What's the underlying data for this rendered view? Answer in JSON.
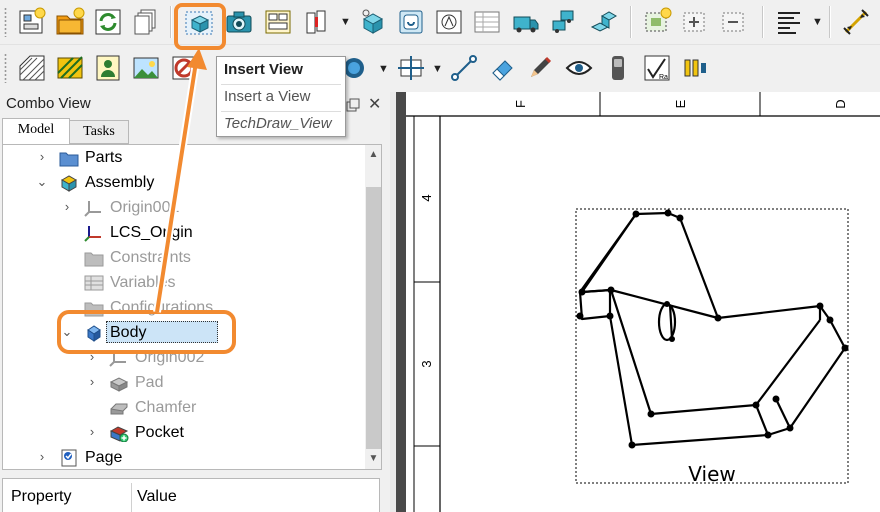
{
  "menu": {
    "items": [
      {
        "label": "Insert View",
        "style": "bold"
      },
      {
        "label": "Insert a View",
        "style": "normal"
      },
      {
        "label": "TechDraw_View",
        "style": "italic"
      }
    ]
  },
  "combo": {
    "title": "Combo View",
    "float_icon": "float-icon",
    "close_glyph": "✕",
    "tabs": [
      "Model",
      "Tasks"
    ]
  },
  "tree": {
    "items": [
      {
        "label": "Parts",
        "icon": "folder-blue-icon",
        "state": "collapsed",
        "grayed": false
      },
      {
        "label": "Assembly",
        "icon": "assembly-icon",
        "state": "expanded",
        "grayed": false
      },
      {
        "label": "Origin001",
        "icon": "origin-icon",
        "state": "collapsed",
        "grayed": true
      },
      {
        "label": "LCS_Origin",
        "icon": "lcs-icon",
        "state": "none",
        "grayed": false
      },
      {
        "label": "Constraints",
        "icon": "folder-gray-icon",
        "state": "none",
        "grayed": true
      },
      {
        "label": "Variables",
        "icon": "variables-icon",
        "state": "none",
        "grayed": true
      },
      {
        "label": "Configurations",
        "icon": "folder-gray-icon",
        "state": "none",
        "grayed": true
      },
      {
        "label": "Body",
        "icon": "body-icon",
        "state": "expanded",
        "grayed": false,
        "selected": true
      },
      {
        "label": "Origin002",
        "icon": "origin-icon",
        "state": "collapsed",
        "grayed": true
      },
      {
        "label": "Pad",
        "icon": "pad-icon",
        "state": "collapsed",
        "grayed": true
      },
      {
        "label": "Chamfer",
        "icon": "chamfer-icon",
        "state": "none",
        "grayed": true
      },
      {
        "label": "Pocket",
        "icon": "pocket-icon",
        "state": "collapsed",
        "grayed": false
      },
      {
        "label": "Page",
        "icon": "page-icon",
        "state": "collapsed",
        "grayed": false
      }
    ]
  },
  "properties": {
    "columns": [
      "Property",
      "Value"
    ]
  },
  "drawing": {
    "frame_letters": [
      "F",
      "E",
      "D"
    ],
    "frame_numbers": [
      "4",
      "3"
    ],
    "view_label": "View"
  },
  "colors": {
    "highlight": "#f28a30",
    "selection": "#cce4f7"
  }
}
